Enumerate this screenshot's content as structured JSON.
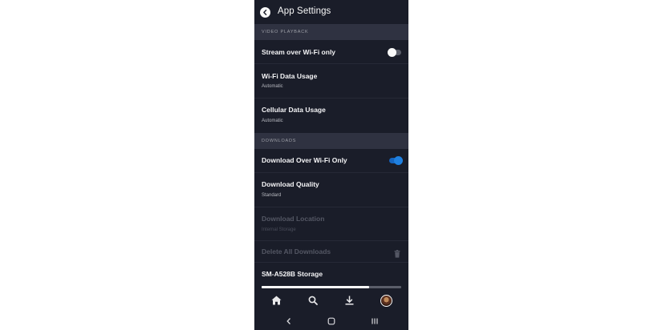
{
  "header": {
    "title": "App Settings"
  },
  "sections": {
    "video": "VIDEO PLAYBACK",
    "downloads": "DOWNLOADS"
  },
  "rows": {
    "stream_wifi": {
      "label": "Stream over Wi-Fi only",
      "toggle_on": false
    },
    "wifi_usage": {
      "label": "Wi-Fi Data Usage",
      "value": "Automatic"
    },
    "cellular_usage": {
      "label": "Cellular Data Usage",
      "value": "Automatic"
    },
    "download_wifi": {
      "label": "Download Over Wi-Fi Only",
      "toggle_on": true
    },
    "download_quality": {
      "label": "Download Quality",
      "value": "Standard"
    },
    "download_location": {
      "label": "Download Location",
      "value": "Internal Storage",
      "disabled": true
    },
    "delete_all": {
      "label": "Delete All Downloads",
      "disabled": true
    },
    "storage": {
      "label": "SM-A528B Storage",
      "used_fraction": 0.77
    }
  },
  "colors": {
    "background": "#1a1d29",
    "section": "#2f3241",
    "accent": "#1f80e0"
  },
  "icons": {
    "back": "back-arrow-icon",
    "trash": "trash-icon",
    "nav": [
      "home-icon",
      "search-icon",
      "download-icon",
      "profile-avatar"
    ],
    "system": [
      "system-back-icon",
      "system-home-icon",
      "system-recents-icon"
    ]
  }
}
